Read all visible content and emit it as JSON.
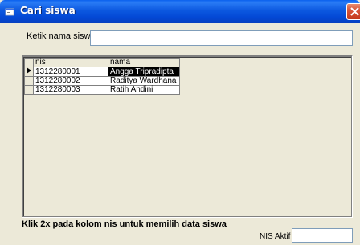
{
  "window": {
    "title": "Cari siswa"
  },
  "search": {
    "label": "Ketik nama siswa",
    "value": ""
  },
  "grid": {
    "columns": [
      "nis",
      "nama"
    ],
    "rows": [
      {
        "nis": "1312280001",
        "nama": "Angga Tripradipta",
        "current": true
      },
      {
        "nis": "1312280002",
        "nama": "Raditya Wardhana",
        "current": false
      },
      {
        "nis": "1312280003",
        "nama": "Ratih Andini",
        "current": false
      }
    ]
  },
  "footer": {
    "hint": "Klik 2x pada kolom nis untuk memilih data siswa",
    "nis_label": "NIS Aktif",
    "nis_value": ""
  },
  "colors": {
    "titlebar": "#0348d5",
    "selection_bg": "#000000",
    "window_bg": "#ece9d8"
  },
  "icons": {
    "app": "form-icon",
    "close": "close-icon",
    "row_pointer": "row-pointer-icon"
  }
}
